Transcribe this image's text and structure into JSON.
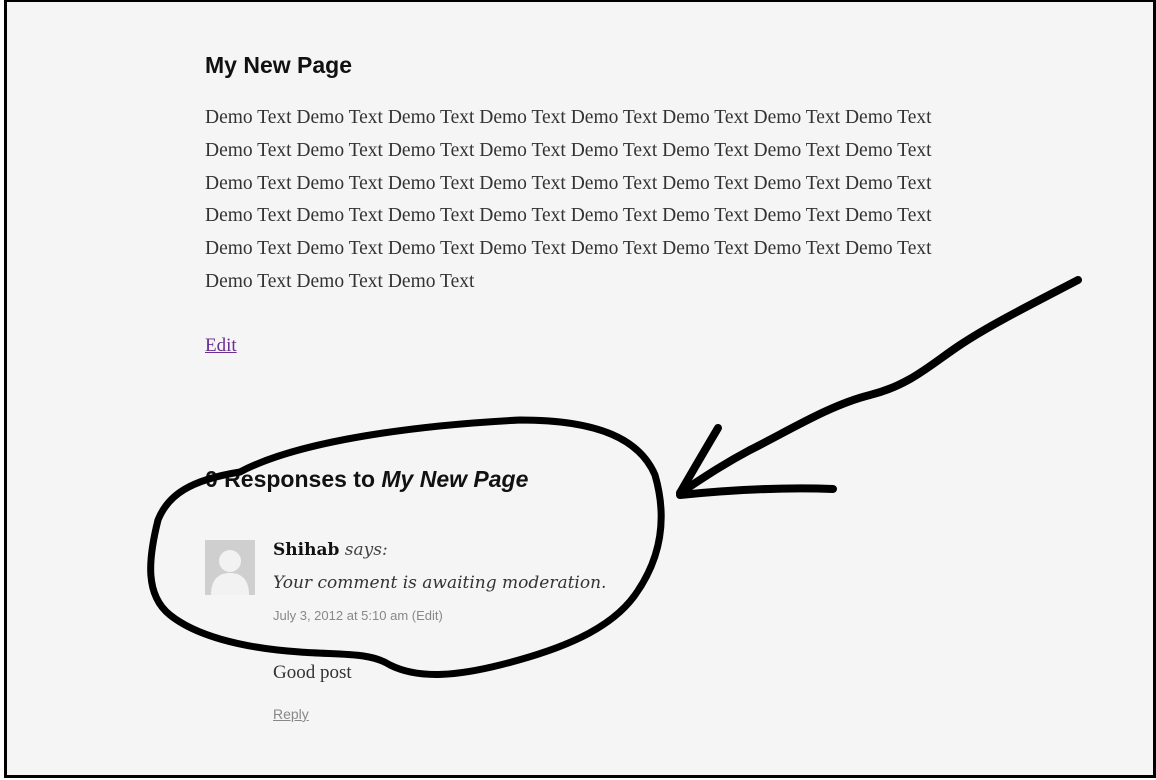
{
  "page": {
    "title": "My New Page",
    "body_text": "Demo Text Demo Text Demo Text Demo Text Demo Text Demo Text Demo Text Demo Text Demo Text Demo Text Demo Text Demo Text Demo Text Demo Text Demo Text Demo Text Demo Text Demo Text Demo Text Demo Text Demo Text Demo Text Demo Text Demo Text Demo Text Demo Text Demo Text Demo Text Demo Text Demo Text Demo Text Demo Text Demo Text Demo Text Demo Text Demo Text Demo Text Demo Text Demo Text Demo Text Demo Text Demo Text Demo Text",
    "edit_label": "Edit"
  },
  "responses": {
    "count_prefix": "0 Responses to ",
    "page_title": "My New Page"
  },
  "comment": {
    "avatar_icon": "default-avatar-icon",
    "author": "Shihab",
    "says": "says:",
    "moderation_notice": "Your comment is awaiting moderation.",
    "date": "July 3, 2012 at 5:10 am",
    "meta_edit_label": "(Edit)",
    "body": "Good post",
    "reply_label": "Reply"
  },
  "annotation": {
    "stroke_color": "#000000",
    "shapes": [
      "hand-drawn-circle",
      "hand-drawn-arrow"
    ]
  }
}
